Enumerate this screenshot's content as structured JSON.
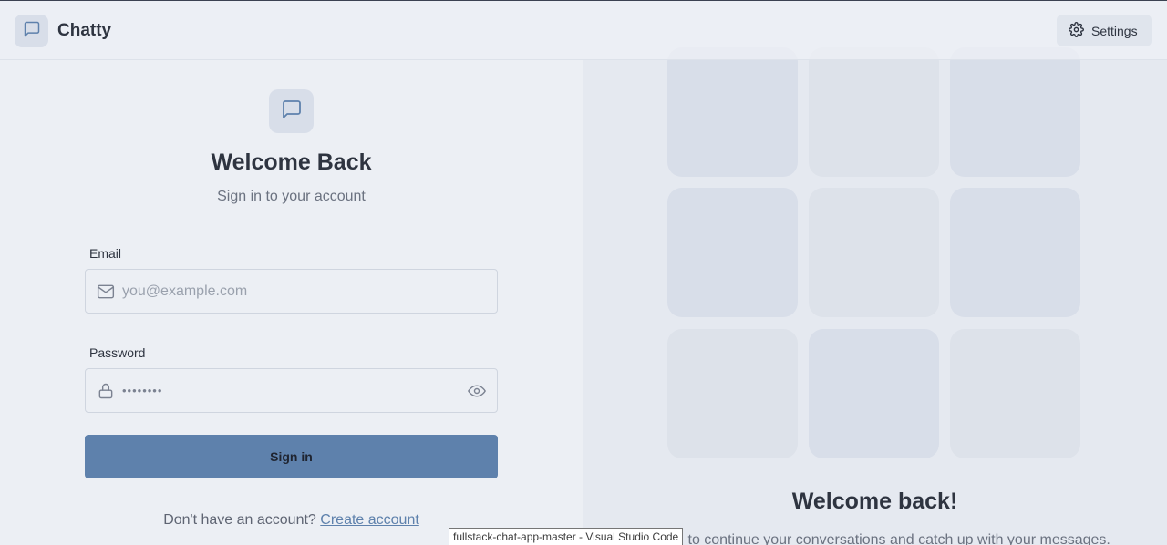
{
  "header": {
    "app_name": "Chatty",
    "logo_icon": "message-square-icon",
    "settings_label": "Settings",
    "settings_icon": "gear-icon"
  },
  "login": {
    "title": "Welcome Back",
    "subtitle": "Sign in to your account",
    "email_label": "Email",
    "email_placeholder": "you@example.com",
    "password_label": "Password",
    "password_value": "••••••••",
    "submit_label": "Sign in",
    "footer_text": "Don't have an account?",
    "footer_link": "Create account"
  },
  "aside": {
    "title": "Welcome back!",
    "subtitle": "Sign in to continue your conversations and catch up with your messages."
  },
  "tooltip": {
    "text": "fullstack-chat-app-master - Visual Studio Code"
  },
  "colors": {
    "primary": "#5e81ac",
    "base": "#eceff4",
    "base_dark": "#e5e9f0",
    "text": "#2e3440"
  }
}
